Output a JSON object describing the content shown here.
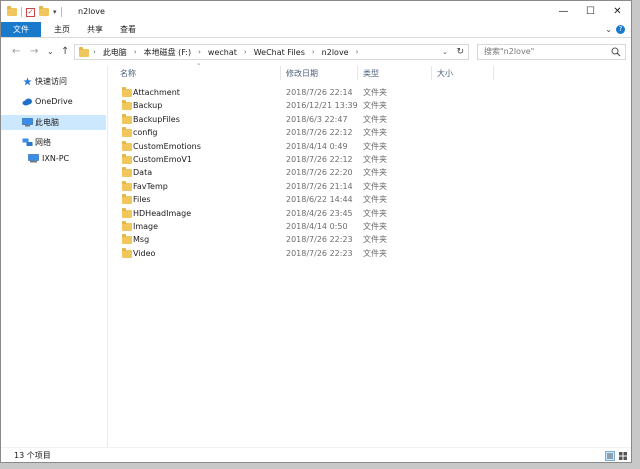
{
  "titlebar": {
    "title": "n2love",
    "qat_dropdown": "▾",
    "minimize": "—",
    "maximize": "☐",
    "close": "✕"
  },
  "menu": {
    "file": "文件",
    "home": "主页",
    "share": "共享",
    "view": "查看",
    "expand": "⌄",
    "help": "?"
  },
  "nav": {
    "back": "←",
    "forward": "→",
    "recent": "⌄",
    "up": "↑",
    "breadcrumbs": [
      "此电脑",
      "本地磁盘 (F:)",
      "wechat",
      "WeChat Files",
      "n2love"
    ],
    "address_dropdown": "⌄",
    "refresh": "↻",
    "search_placeholder": "搜索\"n2love\""
  },
  "sidebar": {
    "items": [
      {
        "label": "快速访问",
        "icon": "star-icon"
      },
      {
        "label": "OneDrive",
        "icon": "cloud-icon"
      },
      {
        "label": "此电脑",
        "icon": "computer-icon"
      },
      {
        "label": "网络",
        "icon": "network-icon"
      },
      {
        "label": "IXN-PC",
        "icon": "pc-icon"
      }
    ]
  },
  "columns": {
    "name": "名称",
    "date": "修改日期",
    "type": "类型",
    "size": "大小",
    "sort_indicator": "˄"
  },
  "files": [
    {
      "name": "Attachment",
      "date": "2018/7/26 22:14",
      "type": "文件夹"
    },
    {
      "name": "Backup",
      "date": "2016/12/21 13:39",
      "type": "文件夹"
    },
    {
      "name": "BackupFiles",
      "date": "2018/6/3 22:47",
      "type": "文件夹"
    },
    {
      "name": "config",
      "date": "2018/7/26 22:12",
      "type": "文件夹"
    },
    {
      "name": "CustomEmotions",
      "date": "2018/4/14 0:49",
      "type": "文件夹"
    },
    {
      "name": "CustomEmoV1",
      "date": "2018/7/26 22:12",
      "type": "文件夹"
    },
    {
      "name": "Data",
      "date": "2018/7/26 22:20",
      "type": "文件夹"
    },
    {
      "name": "FavTemp",
      "date": "2018/7/26 21:14",
      "type": "文件夹"
    },
    {
      "name": "Files",
      "date": "2018/6/22 14:44",
      "type": "文件夹"
    },
    {
      "name": "HDHeadImage",
      "date": "2018/4/26 23:45",
      "type": "文件夹"
    },
    {
      "name": "Image",
      "date": "2018/4/14 0:50",
      "type": "文件夹"
    },
    {
      "name": "Msg",
      "date": "2018/7/26 22:23",
      "type": "文件夹"
    },
    {
      "name": "Video",
      "date": "2018/7/26 22:23",
      "type": "文件夹"
    }
  ],
  "status": {
    "item_count": "13 个项目"
  },
  "colors": {
    "accent": "#1979ca",
    "folder": "#f1c65c",
    "selection": "#cce8ff"
  }
}
